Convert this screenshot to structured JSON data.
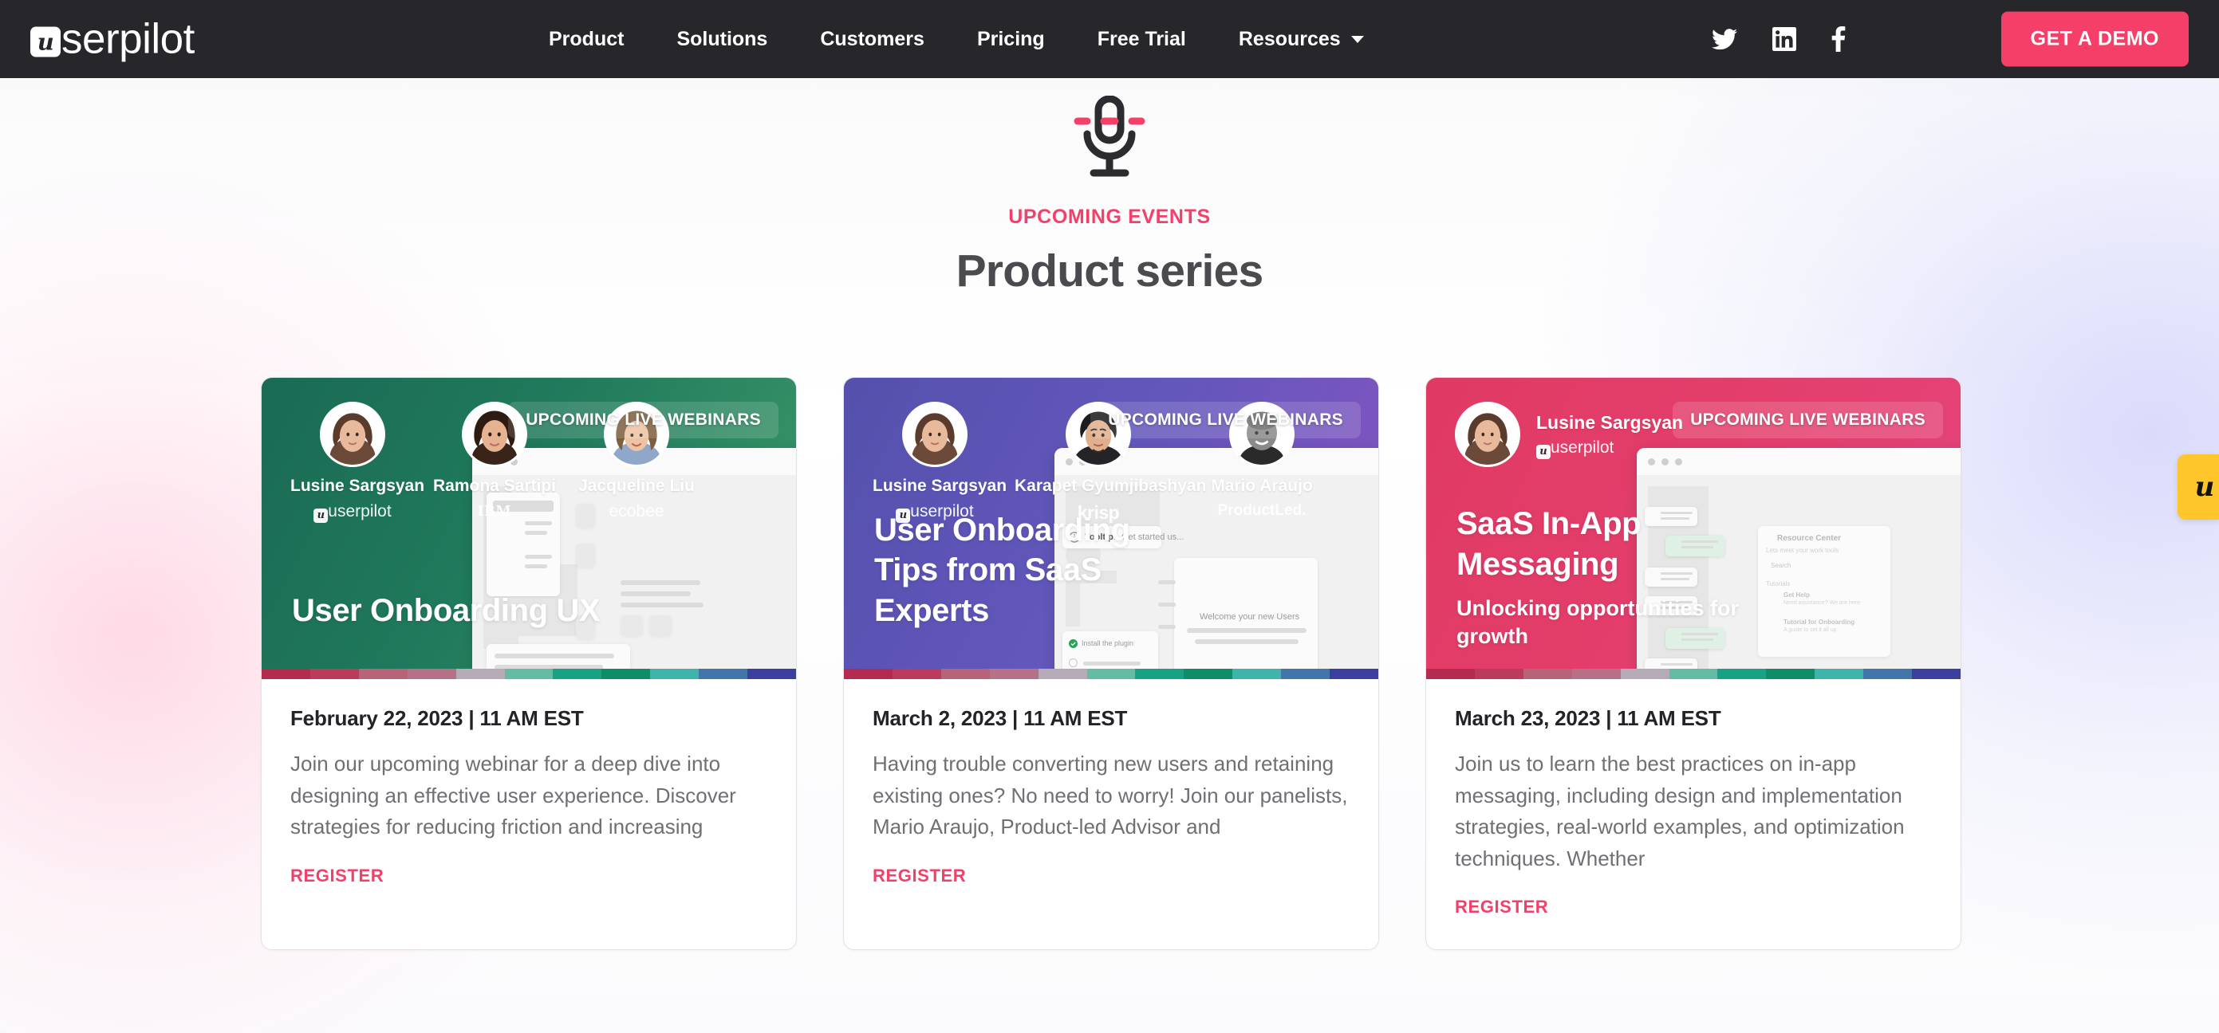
{
  "header": {
    "logo_text": "serpilot",
    "logo_mark": "u",
    "nav": [
      {
        "label": "Product",
        "has_caret": false
      },
      {
        "label": "Solutions",
        "has_caret": false
      },
      {
        "label": "Customers",
        "has_caret": false
      },
      {
        "label": "Pricing",
        "has_caret": false
      },
      {
        "label": "Free Trial",
        "has_caret": false
      },
      {
        "label": "Resources",
        "has_caret": true
      }
    ],
    "social": [
      {
        "name": "twitter-icon"
      },
      {
        "name": "linkedin-icon"
      },
      {
        "name": "facebook-icon"
      }
    ],
    "cta_label": "GET A DEMO",
    "bg_color": "#26262b",
    "accent_color": "#f43f68"
  },
  "hero": {
    "icon": "microphone-icon",
    "eyebrow": "UPCOMING EVENTS",
    "title": "Product series"
  },
  "cards": [
    {
      "badge": "UPCOMING LIVE WEBINARS",
      "theme_color": "#207a5c",
      "media_title": "User Onboarding UX",
      "media_subtitle": "",
      "speakers": [
        {
          "name": "Lusine Sargsyan",
          "org": "userpilot"
        },
        {
          "name": "Ramona Sartipi",
          "org": "IBM"
        },
        {
          "name": "Jacqueline Liu",
          "org": "ecobee"
        }
      ],
      "date": "February 22, 2023 | 11 AM EST",
      "description": "Join our upcoming webinar for a deep dive into designing an effective user experience. Discover strategies for reducing friction and increasing",
      "register_label": "REGISTER"
    },
    {
      "badge": "UPCOMING LIVE WEBINARS",
      "theme_color": "#6257bb",
      "media_title": "User Onboarding Tips from SaaS Experts",
      "media_subtitle": "",
      "speakers": [
        {
          "name": "Lusine Sargsyan",
          "org": "userpilot"
        },
        {
          "name": "Karapet Gyumjibashyan",
          "org": "krisp"
        },
        {
          "name": "Mario Araujo",
          "org": "ProductLed."
        }
      ],
      "date": "March 2, 2023 | 11 AM EST",
      "description": "Having trouble converting new users and retaining existing ones? No need to worry! Join our panelists, Mario Araujo, Product-led Advisor and",
      "register_label": "REGISTER"
    },
    {
      "badge": "UPCOMING LIVE WEBINARS",
      "theme_color": "#e33e6b",
      "media_title": "SaaS In-App Messaging",
      "media_subtitle": "Unlocking opportunities for growth",
      "speakers": [
        {
          "name": "Lusine Sargsyan",
          "org": "userpilot"
        }
      ],
      "date": "March 23, 2023 | 11 AM EST",
      "description": "Join us to learn the best practices on in-app messaging, including design and implementation strategies, real-world examples, and optimization techniques. Whether",
      "register_label": "REGISTER"
    }
  ],
  "color_strip": [
    "#b52a4f",
    "#bc3a5b",
    "#b76378",
    "#b77187",
    "#b5abb7",
    "#62bda4",
    "#17a283",
    "#0d8e69",
    "#3eb4ab",
    "#4276ab",
    "#3b3fa0"
  ],
  "mock": {
    "card2_tooltip_strong": "Tooltip:",
    "card2_tooltip_rest": " Get started us...",
    "card2_welcome": "Welcome your new Users",
    "card2_checklist": "Install the plugin",
    "card3_resource_center": "Resource Center",
    "card3_resource_sub": "Lets meet your work tools",
    "card3_search": "Search",
    "card3_tutorials": "Tutorials",
    "card3_item1": "Get Help",
    "card3_item1_sub": "Need assistance? We are here",
    "card3_item2": "Tutorial for Onboarding",
    "card3_item2_sub": "A guide to set it all up"
  },
  "side_tab": {
    "name": "userpilot-widget-tab",
    "glyph": "u",
    "color": "#ffc62b"
  }
}
